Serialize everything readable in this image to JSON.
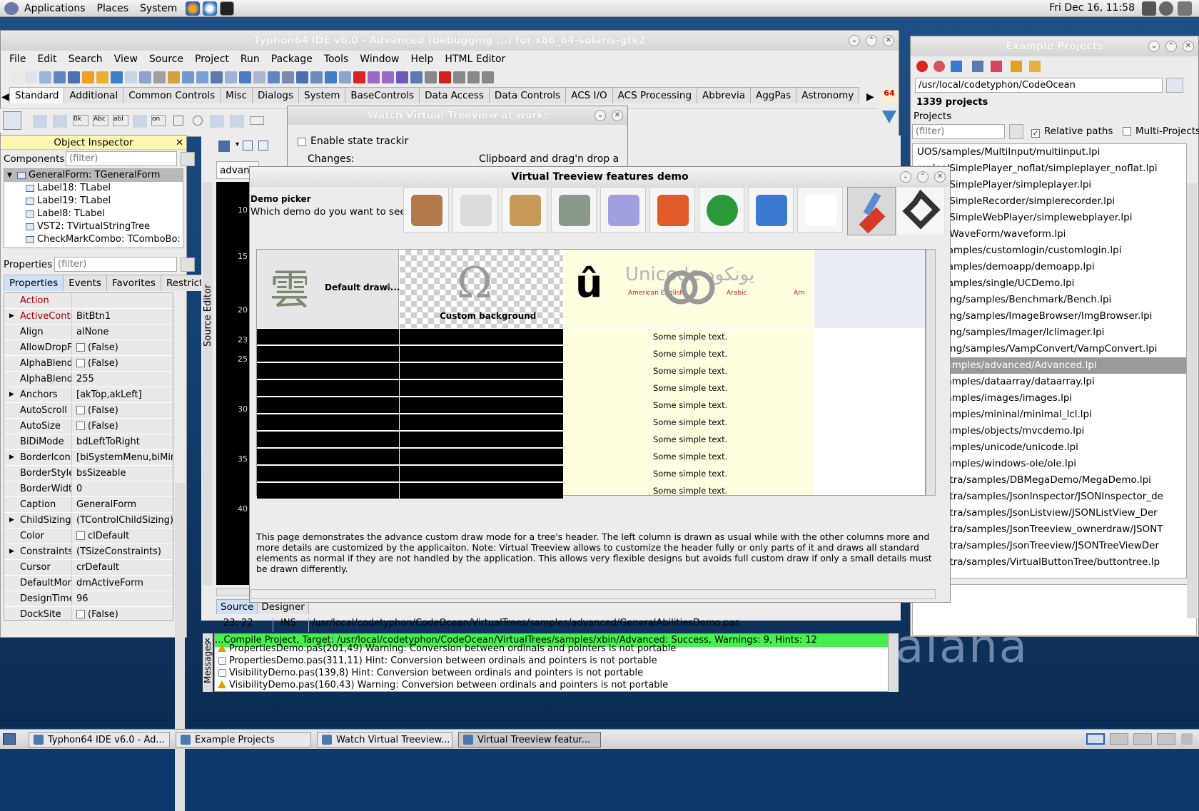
{
  "top_panel": {
    "menus": [
      "Applications",
      "Places",
      "System"
    ],
    "clock": "Fri Dec 16, 11:58"
  },
  "ide": {
    "title": "Typhon64 IDE v6.0 - Advanced (debugging ...) for x86_64-solaris-gtk2",
    "menu": [
      "File",
      "Edit",
      "Search",
      "View",
      "Source",
      "Project",
      "Run",
      "Package",
      "Tools",
      "Window",
      "Help",
      "HTML Editor"
    ],
    "palette_tabs": [
      "Standard",
      "Additional",
      "Common Controls",
      "Misc",
      "Dialogs",
      "System",
      "BaseControls",
      "Data Access",
      "Data Controls",
      "ACS I/O",
      "ACS Processing",
      "Abbrevia",
      "AggPas",
      "Astronomy"
    ],
    "palette_badge": "64",
    "editor_tab": "advanc",
    "source_tabs": [
      "Source",
      "Designer"
    ],
    "status": {
      "pos": "23: 22",
      "mode": "INS",
      "file": "/usr/local/codetyphon/CodeOcean/VirtualTrees/samples/advanced/GeneralAbilitiesDemo.pas"
    },
    "line_numbers": [
      "10",
      "15",
      "20",
      "23",
      "25",
      "30",
      "35",
      "40"
    ],
    "source_editor_label": "Source Editor",
    "messages_label": "Messages",
    "messages": {
      "success": "...Compile Project, Target: /usr/local/codetyphon/CodeOcean/VirtualTrees/samples/xbin/Advanced: Success, Warnings: 9, Hints: 12",
      "lines": [
        {
          "kind": "warn",
          "text": "PropertiesDemo.pas(201,49) Warning: Conversion between ordinals and pointers is not portable"
        },
        {
          "kind": "hint",
          "text": "PropertiesDemo.pas(311,11) Hint: Conversion between ordinals and pointers is not portable"
        },
        {
          "kind": "hint",
          "text": "VisibilityDemo.pas(139,8) Hint: Conversion between ordinals and pointers is not portable"
        },
        {
          "kind": "warn",
          "text": "VisibilityDemo.pas(160,43) Warning: Conversion between ordinals and pointers is not portable"
        }
      ]
    }
  },
  "object_inspector": {
    "title": "Object Inspector",
    "components_label": "Components",
    "filter_placeholder": "(filter)",
    "tree": [
      "GeneralForm: TGeneralForm",
      "Label18: TLabel",
      "Label19: TLabel",
      "Label8: TLabel",
      "VST2: TVirtualStringTree",
      "CheckMarkCombo: TComboBo:"
    ],
    "properties_label": "Properties",
    "tabs": [
      "Properties",
      "Events",
      "Favorites",
      "Restricted"
    ],
    "props": [
      {
        "n": "Action",
        "v": "",
        "exp": false,
        "red": true
      },
      {
        "n": "ActiveControl",
        "v": "BitBtn1",
        "exp": true,
        "red": true
      },
      {
        "n": "Align",
        "v": "alNone",
        "exp": false
      },
      {
        "n": "AllowDropFile",
        "v": "(False)",
        "exp": false,
        "cb": true
      },
      {
        "n": "AlphaBlend",
        "v": "(False)",
        "exp": false,
        "cb": true
      },
      {
        "n": "AlphaBlendVa",
        "v": "255",
        "exp": false
      },
      {
        "n": "Anchors",
        "v": "[akTop,akLeft]",
        "exp": true
      },
      {
        "n": "AutoScroll",
        "v": "(False)",
        "exp": false,
        "cb": true
      },
      {
        "n": "AutoSize",
        "v": "(False)",
        "exp": false,
        "cb": true
      },
      {
        "n": "BiDiMode",
        "v": "bdLeftToRight",
        "exp": false
      },
      {
        "n": "BorderIcons",
        "v": "[biSystemMenu,biMin",
        "exp": true
      },
      {
        "n": "BorderStyle",
        "v": "bsSizeable",
        "exp": false
      },
      {
        "n": "BorderWidth",
        "v": "0",
        "exp": false
      },
      {
        "n": "Caption",
        "v": "GeneralForm",
        "exp": false
      },
      {
        "n": "ChildSizing",
        "v": "(TControlChildSizing)",
        "exp": true
      },
      {
        "n": "Color",
        "v": "clDefault",
        "exp": false,
        "cb": true
      },
      {
        "n": "Constraints",
        "v": "(TSizeConstraints)",
        "exp": true
      },
      {
        "n": "Cursor",
        "v": "crDefault",
        "exp": false
      },
      {
        "n": "DefaultMonito",
        "v": "dmActiveForm",
        "exp": false
      },
      {
        "n": "DesignTimePl",
        "v": "96",
        "exp": false
      },
      {
        "n": "DockSite",
        "v": "(False)",
        "exp": false,
        "cb": true
      }
    ]
  },
  "watch_window": {
    "title": "Watch Virtual Treeview at work:",
    "enable_label": "Enable state trackir",
    "changes_label": "Changes:",
    "clipboard_label": "Clipboard and drag'n drop a"
  },
  "example_projects": {
    "title": "Example Projects",
    "path": "/usr/local/codetyphon/CodeOcean",
    "count": "1339 projects",
    "projects_label": "Projects",
    "filter_placeholder": "(filter)",
    "relative_paths": "Relative paths",
    "multi_projects": "Multi-Projects",
    "items": [
      "UOS/samples/MultiInput/multiinput.lpi",
      "mples/SimplePlayer_noflat/simpleplayer_noflat.lpi",
      "mples/SimplePlayer/simpleplayer.lpi",
      "mples/SimpleRecorder/simplerecorder.lpi",
      "mples/SimpleWebPlayer/simplewebplayer.lpi",
      "mples/WaveForm/waveform.lpi",
      "ntrol/samples/customlogin/customlogin.lpi",
      "ntrol/samples/demoapp/demoapp.lpi",
      "ntrol/samples/single/UCDemo.lpi",
      "eImaging/samples/Benchmark/Bench.lpi",
      "eImaging/samples/ImageBrowser/ImgBrowser.lpi",
      "eImaging/samples/Imager/lclimager.lpi",
      "eImaging/samples/VampConvert/VampConvert.lpi",
      "rees/samples/advanced/Advanced.lpi",
      "rees/samples/dataarray/dataarray.lpi",
      "rees/samples/images/images.lpi",
      "rees/samples/mininal/minimal_lcl.lpi",
      "rees/samples/objects/mvcdemo.lpi",
      "rees/samples/unicode/unicode.lpi",
      "rees/samples/windows-ole/ole.lpi",
      "reesExtra/samples/DBMegaDemo/MegaDemo.lpi",
      "reesExtra/samples/JsonInspector/JSONInspector_de",
      "reesExtra/samples/JsonListview/JSONListView_Der",
      "reesExtra/samples/JsonTreeview_ownerdraw/JSONT",
      "reesExtra/samples/JsonTreeview/JSONTreeViewDer",
      "reesExtra/samples/VirtualButtonTree/buttontree.lp"
    ],
    "selected_index": 13
  },
  "vt_demo": {
    "title": "Virtual Treeview features demo",
    "picker_title": "Demo picker",
    "picker_question": "Which demo do you want to see?",
    "header_col1": "Default drawi...",
    "header_col2": "Custom background",
    "header_col2_glyph": "Ω",
    "header_col3_glyph": "û",
    "header_unicode": "Unicode",
    "header_sub": [
      "American English",
      "Arabic",
      "Arn"
    ],
    "header_arabic": "يونكود",
    "row_text": "Some simple text.",
    "row_count": 10,
    "description": "This page demonstrates the advance custom draw mode for a tree's header. The left column is drawn as usual while with the other columns more and more details are customized by the applicaiton. Note: Virtual Treeview allows to customize the header fully or only parts of it and draws all standard elements as normal if they are not handled by the application. This allows very flexible designs but avoids full custom draw if only a small details must be drawn differently."
  },
  "taskbar": [
    "Typhon64 IDE v6.0 - Ad...",
    "Example Projects",
    "Watch Virtual Treeview...",
    "Virtual Treeview featur..."
  ],
  "desktop_logo": "aiana",
  "colors": {
    "success_bar": "#47f04f",
    "inspector_title": "#fff6b3",
    "selection": "#9a9a9a",
    "vt_yellow": "#fffde0"
  }
}
